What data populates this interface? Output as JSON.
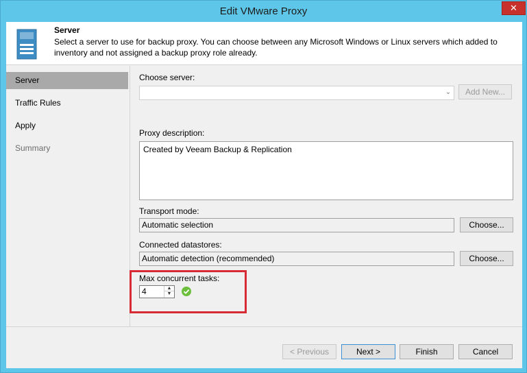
{
  "window": {
    "title": "Edit VMware Proxy",
    "close_label": "✕"
  },
  "header": {
    "title": "Server",
    "description": "Select a server to use for backup proxy. You can choose between any Microsoft Windows or Linux servers which added to inventory and not assigned a backup proxy role already.",
    "icon": "server-icon"
  },
  "sidebar": {
    "items": [
      {
        "label": "Server",
        "state": "active"
      },
      {
        "label": "Traffic Rules",
        "state": "normal"
      },
      {
        "label": "Apply",
        "state": "normal"
      },
      {
        "label": "Summary",
        "state": "disabled"
      }
    ]
  },
  "form": {
    "choose_server_label": "Choose server:",
    "server_value": "",
    "add_new_label": "Add New...",
    "proxy_description_label": "Proxy description:",
    "proxy_description_value": "Created by Veeam Backup & Replication",
    "transport_mode_label": "Transport mode:",
    "transport_mode_value": "Automatic selection",
    "transport_choose_label": "Choose...",
    "datastores_label": "Connected datastores:",
    "datastores_value": "Automatic detection (recommended)",
    "datastores_choose_label": "Choose...",
    "max_tasks_label": "Max concurrent tasks:",
    "max_tasks_value": "4"
  },
  "footer": {
    "previous_label": "< Previous",
    "next_label": "Next >",
    "finish_label": "Finish",
    "cancel_label": "Cancel"
  },
  "colors": {
    "titlebar": "#5ec6e8",
    "close_button": "#c7302b",
    "highlight_box": "#d62b34",
    "check_icon": "#6cbf3c"
  }
}
